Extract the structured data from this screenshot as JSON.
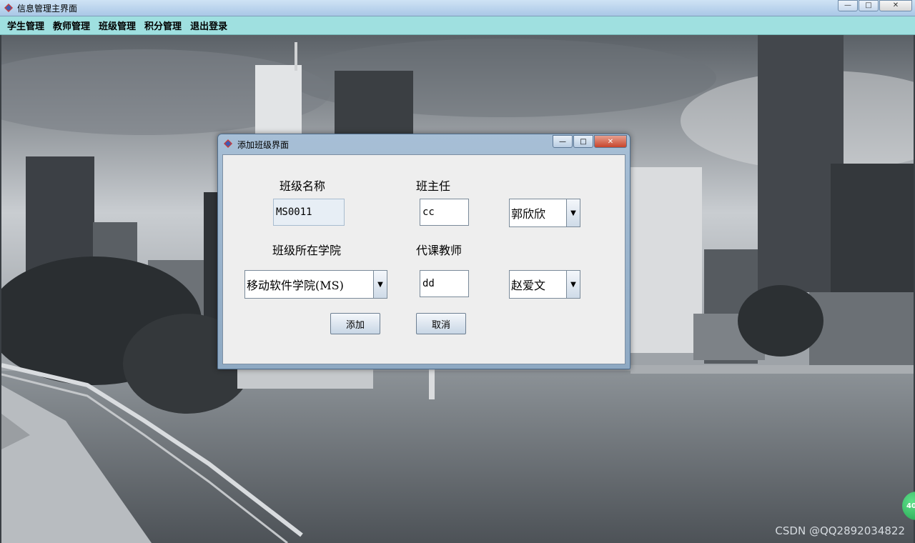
{
  "main_window": {
    "title": "信息管理主界面",
    "controls": {
      "minimize": "—",
      "maximize": "□",
      "close": "✕"
    }
  },
  "menubar": {
    "items": [
      "学生管理",
      "教师管理",
      "班级管理",
      "积分管理",
      "退出登录"
    ]
  },
  "dialog": {
    "title": "添加班级界面",
    "controls": {
      "minimize": "—",
      "maximize": "□",
      "close": "✕"
    },
    "labels": {
      "class_name": "班级名称",
      "head_teacher": "班主任",
      "college": "班级所在学院",
      "course_teacher": "代课教师"
    },
    "fields": {
      "class_name": "MS0011",
      "head_teacher_text": "cc",
      "head_teacher_select": "郭欣欣",
      "college_select": "移动软件学院(MS)",
      "course_teacher_text": "dd",
      "course_teacher_select": "赵爱文"
    },
    "buttons": {
      "add": "添加",
      "cancel": "取消"
    }
  },
  "watermark": "CSDN @QQ2892034822",
  "badge": "40",
  "colors": {
    "menubar": "#9fe0e0",
    "dialog_body": "#eeeeee",
    "close_button": "#c7452c"
  }
}
